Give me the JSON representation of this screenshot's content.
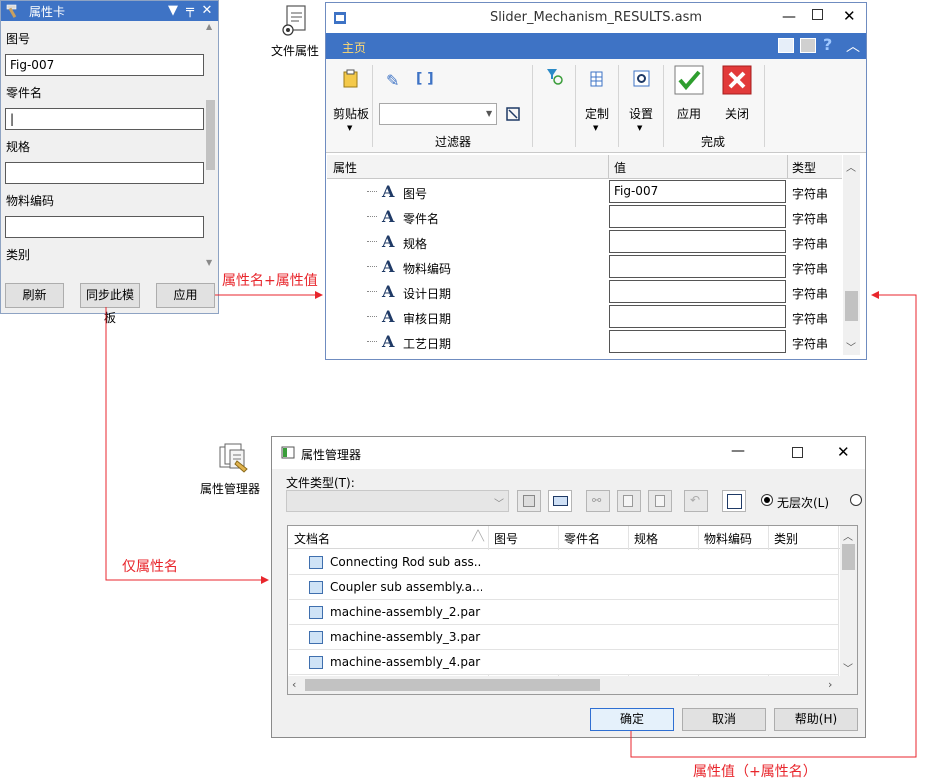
{
  "property_card": {
    "title": "属性卡",
    "fields": [
      {
        "label": "图号",
        "value": "Fig-007"
      },
      {
        "label": "零件名",
        "value": "|"
      },
      {
        "label": "规格",
        "value": ""
      },
      {
        "label": "物料编码",
        "value": ""
      },
      {
        "label": "类别",
        "value": ""
      }
    ],
    "buttons": {
      "refresh": "刷新",
      "sync": "同步此模板",
      "apply": "应用"
    }
  },
  "file_property": {
    "label": "文件属性"
  },
  "slider_window": {
    "title": "Slider_Mechanism_RESULTS.asm",
    "home_tab": "主页",
    "ribbon": {
      "clipboard": "剪贴板",
      "filter_group": "过滤器",
      "customize": "定制",
      "settings": "设置",
      "apply": "应用",
      "close": "关闭",
      "finish_group": "完成"
    },
    "grid": {
      "headers": {
        "property": "属性",
        "value": "值",
        "type": "类型"
      },
      "rows": [
        {
          "name": "图号",
          "value": "Fig-007",
          "type": "字符串"
        },
        {
          "name": "零件名",
          "value": "",
          "type": "字符串"
        },
        {
          "name": "规格",
          "value": "",
          "type": "字符串"
        },
        {
          "name": "物料编码",
          "value": "",
          "type": "字符串"
        },
        {
          "name": "设计日期",
          "value": "",
          "type": "字符串"
        },
        {
          "name": "审核日期",
          "value": "",
          "type": "字符串"
        },
        {
          "name": "工艺日期",
          "value": "",
          "type": "字符串"
        }
      ]
    }
  },
  "property_manager": {
    "label": "属性管理器",
    "dialog": {
      "title": "属性管理器",
      "file_type_label": "文件类型(T):",
      "radio_no_level": "无层次(L)",
      "table": {
        "headers": [
          "文档名",
          "图号",
          "零件名",
          "规格",
          "物料编码",
          "类别"
        ],
        "rows": [
          {
            "name": "Connecting Rod sub ass..."
          },
          {
            "name": "Coupler sub assembly.a..."
          },
          {
            "name": "machine-assembly_2.par"
          },
          {
            "name": "machine-assembly_3.par"
          },
          {
            "name": "machine-assembly_4.par"
          }
        ]
      },
      "buttons": {
        "ok": "确定",
        "cancel": "取消",
        "help": "帮助(H)"
      }
    }
  },
  "annotations": {
    "name_and_value": "属性名+属性值",
    "name_only": "仅属性名",
    "value_plus_name": "属性值（+属性名）"
  },
  "colors": {
    "accent": "#3e73c5",
    "annotation": "#e8262c",
    "ribbon_tab_text": "#ffd971"
  }
}
